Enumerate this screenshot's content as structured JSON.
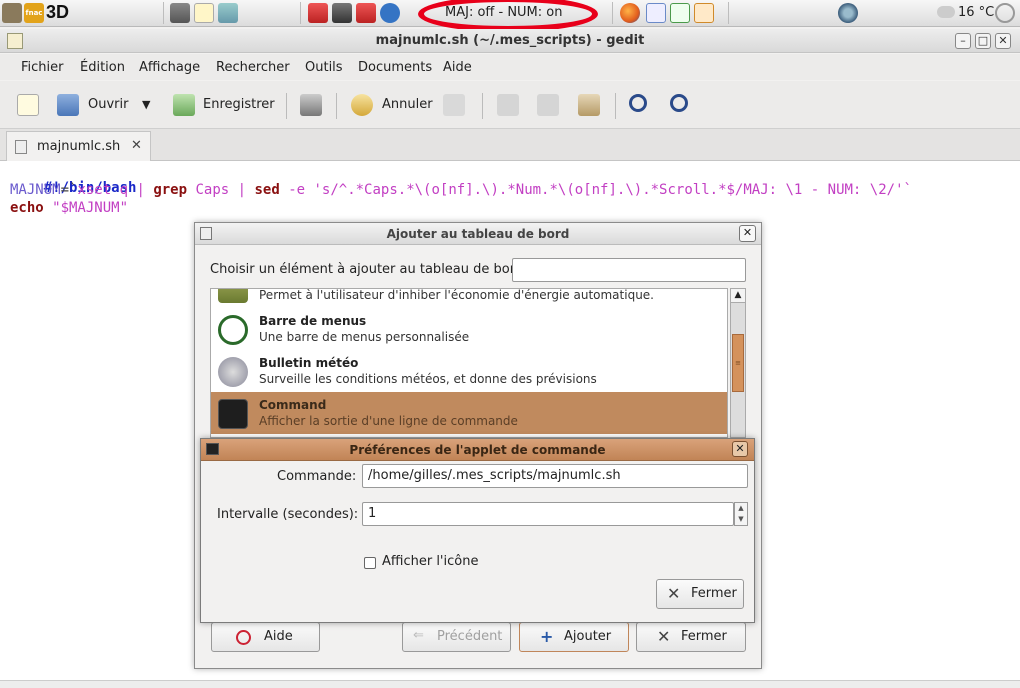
{
  "top_panel": {
    "indicator_text": "MAJ: off - NUM: on",
    "text_3d": "3D",
    "fnac_label": "fnac",
    "weather_temp": "16 °C",
    "launchers": [
      "gimp-icon",
      "fnac-icon",
      "screenshot-icon",
      "text-editor-icon",
      "calculator-icon",
      "pdf-icon",
      "camera-icon",
      "acrobat-icon",
      "accessibility-icon",
      "firefox-icon",
      "writer-icon",
      "calc-icon",
      "impress-icon",
      "thunderbird-icon"
    ]
  },
  "window": {
    "title": "majnumlc.sh (~/.mes_scripts) - gedit",
    "minimize": "–",
    "maximize": "□",
    "close": "✕"
  },
  "menubar": [
    "Fichier",
    "Édition",
    "Affichage",
    "Rechercher",
    "Outils",
    "Documents",
    "Aide"
  ],
  "toolbar": {
    "open_label": "Ouvrir",
    "save_label": "Enregistrer",
    "undo_label": "Annuler"
  },
  "tab": {
    "label": "majnumlc.sh",
    "close": "✕"
  },
  "code": {
    "line1": "#!/bin/bash",
    "line2_var": "MAJNUM",
    "line2_eq": "=`",
    "line2_cmd1": "xset q",
    "line2_pipe1": " | ",
    "line2_grep": "grep",
    "line2_caps": " Caps ",
    "line2_pipe2": "| ",
    "line2_sed": "sed",
    "line2_opt": " -e ",
    "line2_str": "'s/^.*Caps.*\\(o[nf].\\).*Num.*\\(o[nf].\\).*Scroll.*$/MAJ: \\1 - NUM: \\2/'`",
    "line3_echo": "echo",
    "line3_str": " \"$MAJNUM\""
  },
  "add_dialog": {
    "title": "Ajouter au tableau de bord",
    "close": "✕",
    "choose_label": "Choisir un élément à ajouter au tableau de bord :",
    "search_value": "",
    "items": [
      {
        "name": "",
        "desc": "Permet à l'utilisateur d'inhiber l'économie d'énergie automatique."
      },
      {
        "name": "Barre de menus",
        "desc": "Une barre de menus personnalisée"
      },
      {
        "name": "Bulletin météo",
        "desc": "Surveille les conditions météos, et donne des prévisions"
      },
      {
        "name": "Command",
        "desc": "Afficher la sortie d'une ligne de commande"
      }
    ],
    "buttons": {
      "help": "Aide",
      "previous": "Précédent",
      "add": "Ajouter",
      "close": "Fermer"
    }
  },
  "pref_dialog": {
    "title": "Préférences de l'applet de commande",
    "close": "✕",
    "command_label": "Commande:",
    "command_value": "/home/gilles/.mes_scripts/majnumlc.sh",
    "interval_label": "Intervalle (secondes):",
    "interval_value": "1",
    "show_icon_label": "Afficher l'icône",
    "show_icon_checked": false,
    "close_button": "Fermer"
  }
}
